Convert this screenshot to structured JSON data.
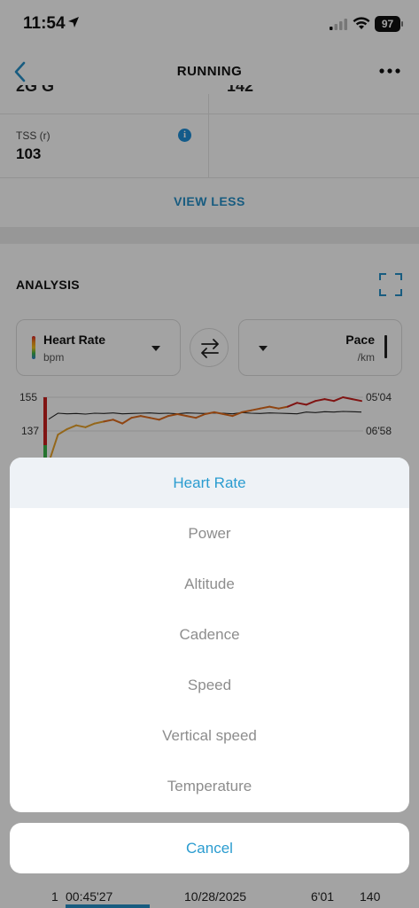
{
  "status_bar": {
    "time": "11:54",
    "battery": "97",
    "icons": [
      "location-arrow-icon",
      "cellular-signal-icon",
      "wifi-icon",
      "battery-icon"
    ]
  },
  "nav": {
    "title": "RUNNING",
    "back_icon": "chevron-left-icon",
    "more_icon": "more-horizontal-icon"
  },
  "stats": {
    "cut_left": "2G G",
    "cut_right": "142",
    "tss_label": "TSS (r)",
    "tss_value": "103",
    "view_less": "VIEW LESS"
  },
  "analysis": {
    "title": "ANALYSIS",
    "left_selector": {
      "title": "Heart Rate",
      "unit": "bpm"
    },
    "right_selector": {
      "title": "Pace",
      "unit": "/km"
    }
  },
  "chart_data": {
    "type": "line",
    "left_axis_ticks": [
      "155",
      "137"
    ],
    "right_axis_ticks": [
      "05'04",
      "06'58"
    ],
    "series": [
      {
        "name": "Heart Rate",
        "values": [
          120,
          135,
          138,
          140,
          139,
          141,
          142,
          143,
          141,
          144,
          145,
          144,
          143,
          145,
          146,
          145,
          144,
          146,
          147,
          146,
          145,
          147,
          148,
          149,
          150,
          149,
          150,
          152,
          151,
          153,
          154,
          153,
          155,
          154,
          153
        ]
      },
      {
        "name": "Pace",
        "values": [
          330,
          310,
          312,
          311,
          313,
          310,
          311,
          309,
          312,
          311,
          310,
          309,
          311,
          310,
          312,
          309,
          310,
          311,
          309,
          310,
          312,
          308,
          310,
          311,
          309,
          310,
          311,
          312,
          306,
          308,
          305,
          306,
          304,
          305,
          306
        ]
      }
    ],
    "colors": {
      "hr_low": "#e8a22a",
      "hr_mid": "#e06b1c",
      "hr_high": "#c8201f",
      "pace": "#222222"
    }
  },
  "background_row": {
    "index": "1",
    "duration": "00:45'27",
    "date": "10/28/2025",
    "pace": "6'01",
    "hr": "140"
  },
  "sheet": {
    "options": [
      "Heart Rate",
      "Power",
      "Altitude",
      "Cadence",
      "Speed",
      "Vertical speed",
      "Temperature"
    ],
    "selected_index": 0,
    "cancel": "Cancel"
  },
  "colors": {
    "accent": "#2a9cd0",
    "overlay": "rgba(0,0,0,0.36)"
  }
}
